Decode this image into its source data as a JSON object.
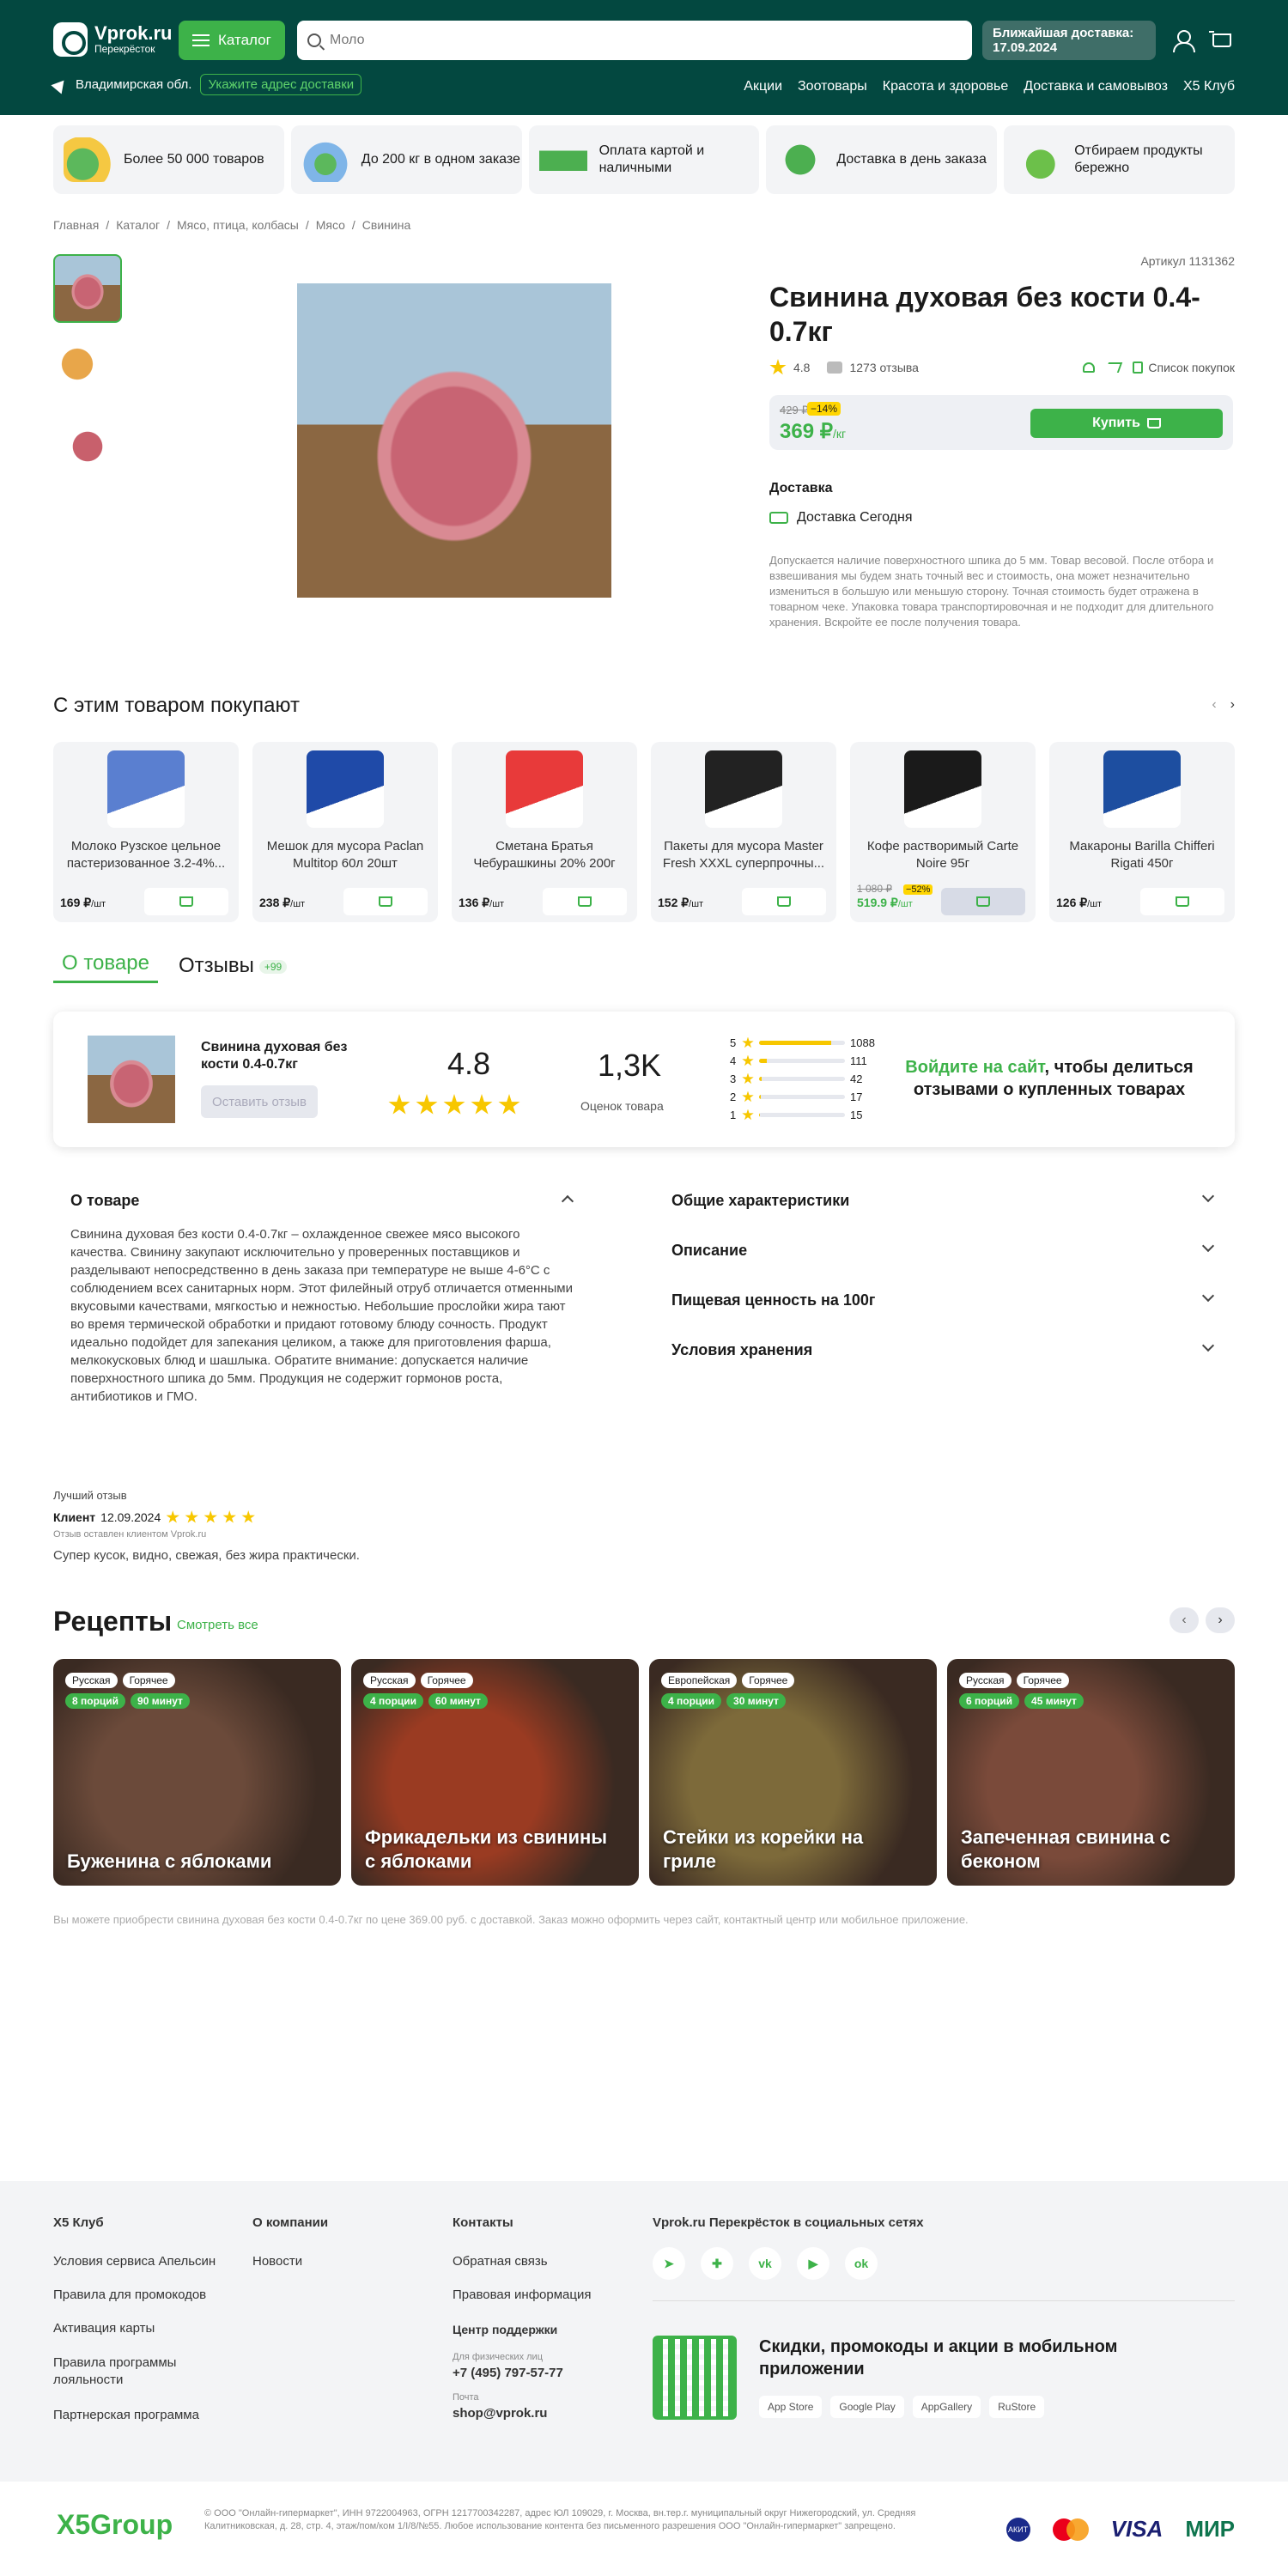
{
  "header": {
    "logo_title": "Vprok.ru",
    "logo_sub": "Перекрёсток",
    "catalog": "Каталог",
    "search_placeholder": "Моло",
    "delivery_label": "Ближайшая доставка:",
    "delivery_date": "17.09.2024",
    "region": "Владимирская обл.",
    "address_btn": "Укажите адрес доставки",
    "nav": [
      "Акции",
      "Зоотовары",
      "Красота и здоровье",
      "Доставка и самовывоз",
      "X5 Клуб"
    ]
  },
  "benefits": [
    "Более 50 000 товаров",
    "До 200 кг в одном заказе",
    "Оплата картой и наличными",
    "Доставка в день заказа",
    "Отбираем продукты бережно"
  ],
  "breadcrumb": [
    "Главная",
    "/",
    "Каталог",
    "/",
    "Мясо, птица, колбасы",
    "/",
    "Мясо",
    "/",
    "Свинина"
  ],
  "product": {
    "article": "Артикул 1131362",
    "title": "Свинина духовая без кости 0.4-0.7кг",
    "rating": "4.8",
    "reviews": "1273 отзыва",
    "shopping_list": "Список покупок",
    "old_price": "429 ₽",
    "discount": "−14%",
    "price": "369 ₽",
    "unit": "/кг",
    "buy": "Купить",
    "delivery_title": "Доставка",
    "delivery_today": "Доставка Сегодня",
    "note": "Допускается наличие поверхностного шпика до 5 мм. Товар весовой. После отбора и взвешивания мы будем знать точный вес и стоимость, она может незначительно измениться в большую или меньшую сторону. Точная стоимость будет отражена в товарном чеке. Упаковка товара транспортировочная и не подходит для длительного хранения. Вскройте ее после получения товара."
  },
  "also": {
    "title": "С этим товаром покупают",
    "items": [
      {
        "name": "Молоко Рузское цельное пастеризованное 3.2-4%...",
        "price": "169 ₽",
        "unit": "/шт",
        "color": "#5a7fd0"
      },
      {
        "name": "Мешок для мусора Paclan Multitop 60л 20шт",
        "price": "238 ₽",
        "unit": "/шт",
        "color": "#1f4aa8"
      },
      {
        "name": "Сметана Братья Чебурашкины 20% 200г",
        "price": "136 ₽",
        "unit": "/шт",
        "color": "#e83a3a"
      },
      {
        "name": "Пакеты для мусора Master Fresh XXXL суперпрочны...",
        "price": "152 ₽",
        "unit": "/шт",
        "color": "#222222"
      },
      {
        "name": "Кофе растворимый Carte Noire 95г",
        "price": "519.9 ₽",
        "unit": "/шт",
        "old": "1 080 ₽",
        "disc": "−52%",
        "color": "#1a1a1a"
      },
      {
        "name": "Макароны Barilla Chifferi Rigati 450г",
        "price": "126 ₽",
        "unit": "/шт",
        "color": "#1d4ea0"
      }
    ]
  },
  "tabs": {
    "about": "О товаре",
    "reviews": "Отзывы",
    "count": "+99"
  },
  "review_box": {
    "name": "Свинина духовая без кости 0.4-0.7кг",
    "leave": "Оставить отзыв",
    "rating": "4.8",
    "count": "1,3K",
    "count_label": "Оценок товара",
    "dist": [
      {
        "s": "5",
        "n": "1088",
        "f": 0.84
      },
      {
        "s": "4",
        "n": "111",
        "f": 0.09
      },
      {
        "s": "3",
        "n": "42",
        "f": 0.03
      },
      {
        "s": "2",
        "n": "17",
        "f": 0.015
      },
      {
        "s": "1",
        "n": "15",
        "f": 0.012
      }
    ],
    "login_link": "Войдите на сайт",
    "login_rest": ", чтобы делиться отзывами о купленных товарах"
  },
  "about": {
    "title": "О товаре",
    "text": "Свинина духовая без кости 0.4-0.7кг – охлажденное свежее мясо высокого качества. Свинину закупают исключительно у проверенных поставщиков и разделывают непосредственно в день заказа при температуре не выше 4-6°C с соблюдением всех санитарных норм. Этот филейный отруб отличается отменными вкусовыми качествами, мягкостью и нежностью. Небольшие прослойки жира тают во время термической обработки и придают готовому блюду сочность. Продукт идеально подойдет для запекания целиком, а также для приготовления фарша, мелкокусковых блюд и шашлыка. Обратите внимание: допускается наличие поверхностного шпика до 5мм. Продукция не содержит гормонов роста, антибиотиков и ГМО.",
    "sections": [
      "Общие характеристики",
      "Описание",
      "Пищевая ценность на 100г",
      "Условия хранения"
    ]
  },
  "best": {
    "label": "Лучший отзыв",
    "author": "Клиент",
    "date": "12.09.2024",
    "source": "Отзыв оставлен клиентом Vprok.ru",
    "text": "Супер кусок, видно, свежая, без жира практически."
  },
  "recipes": {
    "title": "Рецепты",
    "all": "Смотреть все",
    "items": [
      {
        "c": "Русская",
        "k": "Горячее",
        "p": "8 порций",
        "t": "90 минут",
        "name": "Буженина с яблоками",
        "bg": "#6b4a3a"
      },
      {
        "c": "Русская",
        "k": "Горячее",
        "p": "4 порции",
        "t": "60 минут",
        "name": "Фрикадельки из свинины с яблоками",
        "bg": "#9a3b22"
      },
      {
        "c": "Европейская",
        "k": "Горячее",
        "p": "4 порции",
        "t": "30 минут",
        "name": "Стейки из корейки на гриле",
        "bg": "#7d6a3a"
      },
      {
        "c": "Русская",
        "k": "Горячее",
        "p": "6 порций",
        "t": "45 минут",
        "name": "Запеченная свинина с беконом",
        "bg": "#7a4a3a"
      }
    ]
  },
  "disclaimer": "Вы можете приобрести свинина духовая без кости 0.4-0.7кг по цене 369.00 руб. с доставкой. Заказ можно оформить через сайт, контактный центр или мобильное приложение.",
  "footer": {
    "col1_title": "X5 Клуб",
    "col1": [
      "Условия сервиса Апельсин",
      "Правила для промокодов",
      "Активация карты",
      "Правила программы лояльности",
      "Партнерская программа"
    ],
    "col2_title": "О компании",
    "col2": [
      "Новости"
    ],
    "col3_title": "Контакты",
    "col3": [
      "Обратная связь",
      "Правовая информация"
    ],
    "support_title": "Центр поддержки",
    "phys_label": "Для физических лиц",
    "phone": "+7 (495) 797-57-77",
    "mail_label": "Почта",
    "mail": "shop@vprok.ru",
    "social_title": "Vprok.ru Перекрёсток в социальных сетях",
    "app_text": "Скидки, промокоды и акции в мобильном приложении",
    "stores": [
      "App Store",
      "Google Play",
      "AppGallery",
      "RuStore"
    ],
    "legal": "© ООО \"Онлайн-гипермаркет\", ИНН 9722004963, ОГРН 1217700342287, адрес ЮЛ 109029, г. Москва, вн.тер.г. муниципальный округ Нижегородский, ул. Средняя Калитниковская, д. 28, стр. 4, этаж/пом/ком 1/I/8/№55. Любое использование контента без письменного разрешения ООО \"Онлайн-гипермаркет\" запрещено.",
    "x5": "X5Group",
    "pays": [
      "АКИТ",
      "VISA",
      "МИР"
    ]
  }
}
